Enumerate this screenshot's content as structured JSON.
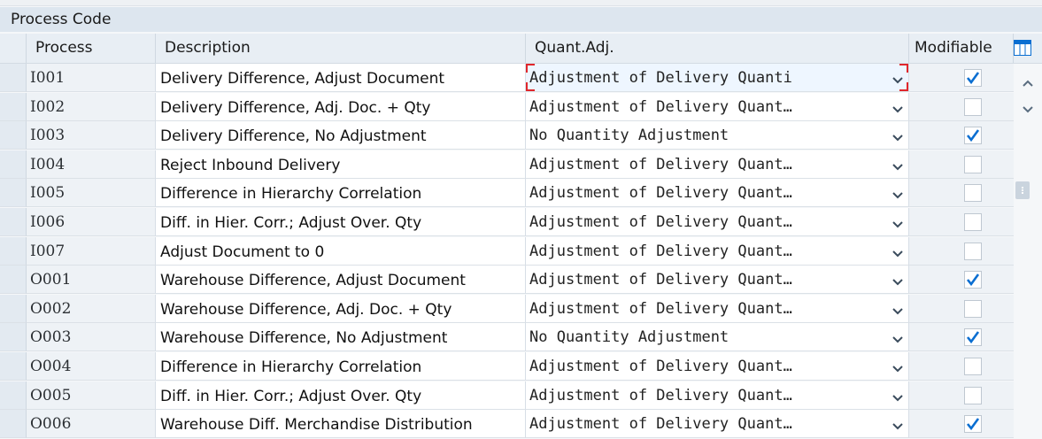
{
  "table": {
    "title": "Process Code",
    "columns": {
      "process": "Process",
      "description": "Description",
      "quant_adj": "Quant.Adj.",
      "modifiable": "Modifiable"
    },
    "rows": [
      {
        "process": "I001",
        "description": "Delivery Difference, Adjust Document",
        "quant_adj": "Adjustment of Delivery Quanti",
        "modifiable": true,
        "focused": true
      },
      {
        "process": "I002",
        "description": "Delivery Difference, Adj. Doc. + Qty",
        "quant_adj": "Adjustment of Delivery Quant…",
        "modifiable": false
      },
      {
        "process": "I003",
        "description": "Delivery Difference, No Adjustment",
        "quant_adj": "No Quantity Adjustment",
        "modifiable": true
      },
      {
        "process": "I004",
        "description": "Reject Inbound Delivery",
        "quant_adj": "Adjustment of Delivery Quant…",
        "modifiable": false
      },
      {
        "process": "I005",
        "description": "Difference in Hierarchy Correlation",
        "quant_adj": "Adjustment of Delivery Quant…",
        "modifiable": false
      },
      {
        "process": "I006",
        "description": "Diff. in Hier. Corr.; Adjust Over. Qty",
        "quant_adj": "Adjustment of Delivery Quant…",
        "modifiable": false
      },
      {
        "process": "I007",
        "description": "Adjust Document to 0",
        "quant_adj": "Adjustment of Delivery Quant…",
        "modifiable": false
      },
      {
        "process": "O001",
        "description": "Warehouse Difference, Adjust Document",
        "quant_adj": "Adjustment of Delivery Quant…",
        "modifiable": true
      },
      {
        "process": "O002",
        "description": "Warehouse Difference, Adj. Doc. + Qty",
        "quant_adj": "Adjustment of Delivery Quant…",
        "modifiable": false
      },
      {
        "process": "O003",
        "description": "Warehouse Difference, No Adjustment",
        "quant_adj": "No Quantity Adjustment",
        "modifiable": true
      },
      {
        "process": "O004",
        "description": "Difference in Hierarchy Correlation",
        "quant_adj": "Adjustment of Delivery Quant…",
        "modifiable": false
      },
      {
        "process": "O005",
        "description": "Diff. in Hier. Corr.; Adjust Over. Qty",
        "quant_adj": "Adjustment of Delivery Quant…",
        "modifiable": false
      },
      {
        "process": "O006",
        "description": "Warehouse Diff. Merchandise Distribution",
        "quant_adj": "Adjustment of Delivery Quant…",
        "modifiable": true
      }
    ]
  },
  "icons": {
    "layout": "table-layout-icon",
    "scroll_up": "chevron-up-icon",
    "scroll_down": "chevron-down-icon",
    "dropdown": "chevron-down-icon",
    "checkmark": "checkmark-icon"
  },
  "colors": {
    "accent": "#0a6ed1",
    "focus": "#e0262b"
  }
}
